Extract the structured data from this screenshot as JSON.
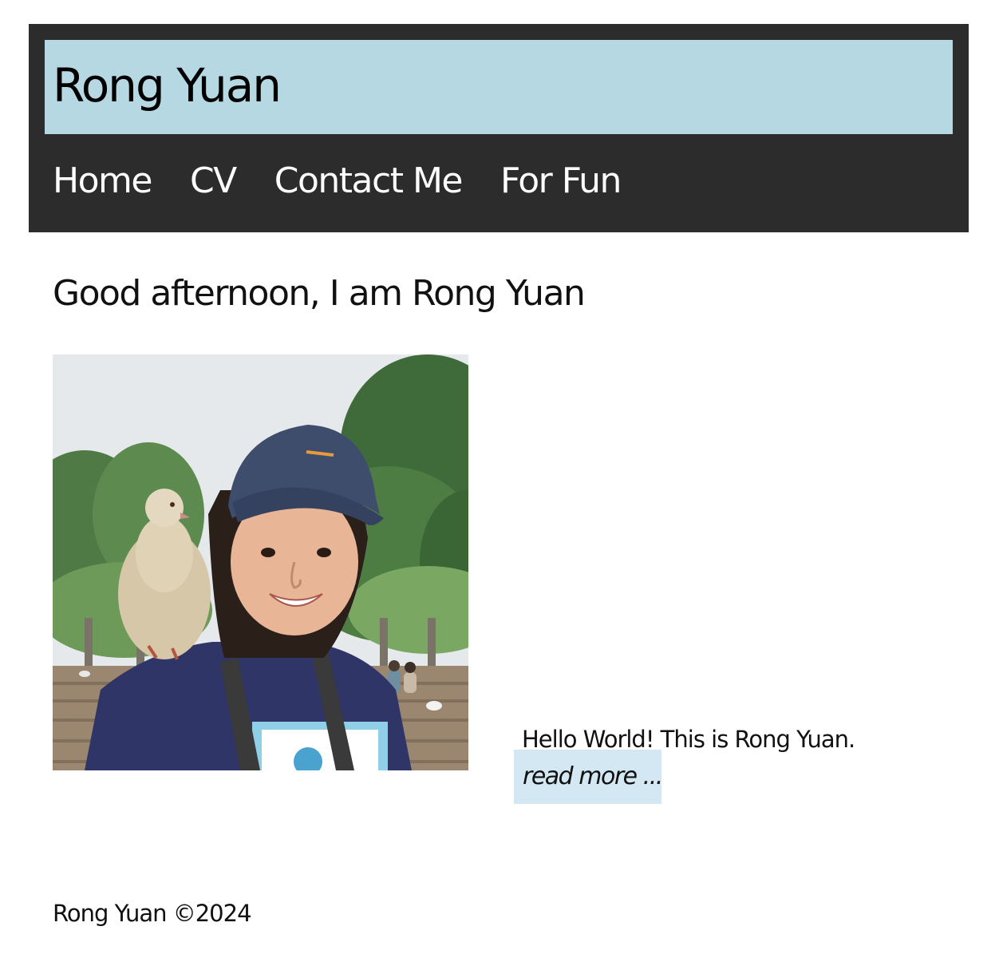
{
  "header": {
    "site_title": "Rong Yuan",
    "title_bar_color": "#b5d8e3",
    "nav_background": "#2c2c2c",
    "nav": [
      {
        "label": "Home"
      },
      {
        "label": "CV"
      },
      {
        "label": "Contact Me"
      },
      {
        "label": "For Fun"
      }
    ]
  },
  "main": {
    "greeting": "Good afternoon, I am Rong Yuan",
    "photo": {
      "icon": "profile-photo"
    },
    "intro_text": "Hello World! This is Rong Yuan.",
    "read_more_label": "read more ...",
    "read_more_color": "#d3e8f3"
  },
  "footer": {
    "copyright": "Rong Yuan ©2024"
  }
}
